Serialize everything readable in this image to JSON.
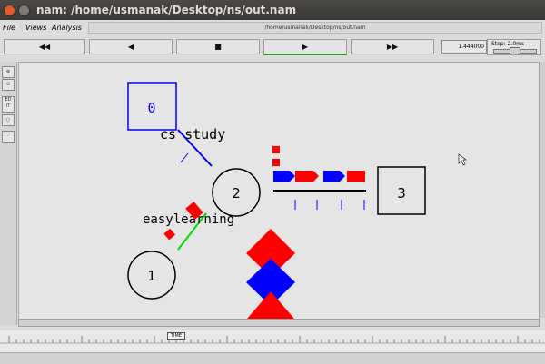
{
  "window": {
    "title": "nam: /home/usmanak/Desktop/ns/out.nam"
  },
  "menu": {
    "file": "File",
    "views": "Views",
    "analysis": "Analysis"
  },
  "path": "/home/usmanak/Desktop/ns/out.nam",
  "controls": {
    "rewind": "◀◀",
    "back": "◀",
    "stop": "■",
    "play": "▶",
    "fastforward": "▶▶",
    "time": "1.444000",
    "step_label": "Step: 2.0ms"
  },
  "tools": {
    "zoom_in": "zoom in",
    "zoom_out": "zoom out",
    "edit": "ED IT"
  },
  "network": {
    "nodes": [
      {
        "id": "node-0",
        "label": "0",
        "shape": "box",
        "color": "#0000ff"
      },
      {
        "id": "node-1",
        "label": "1",
        "shape": "circle",
        "color": "#000000"
      },
      {
        "id": "node-2",
        "label": "2",
        "shape": "circle",
        "color": "#000000"
      },
      {
        "id": "node-3",
        "label": "3",
        "shape": "box",
        "color": "#000000"
      }
    ],
    "annotations": [
      "cs study",
      "easylearning"
    ],
    "colors": {
      "blue": "#0000ff",
      "red": "#ff0000",
      "green": "#00dd00",
      "black": "#000000"
    }
  },
  "timeline": {
    "marker": "TIME"
  }
}
